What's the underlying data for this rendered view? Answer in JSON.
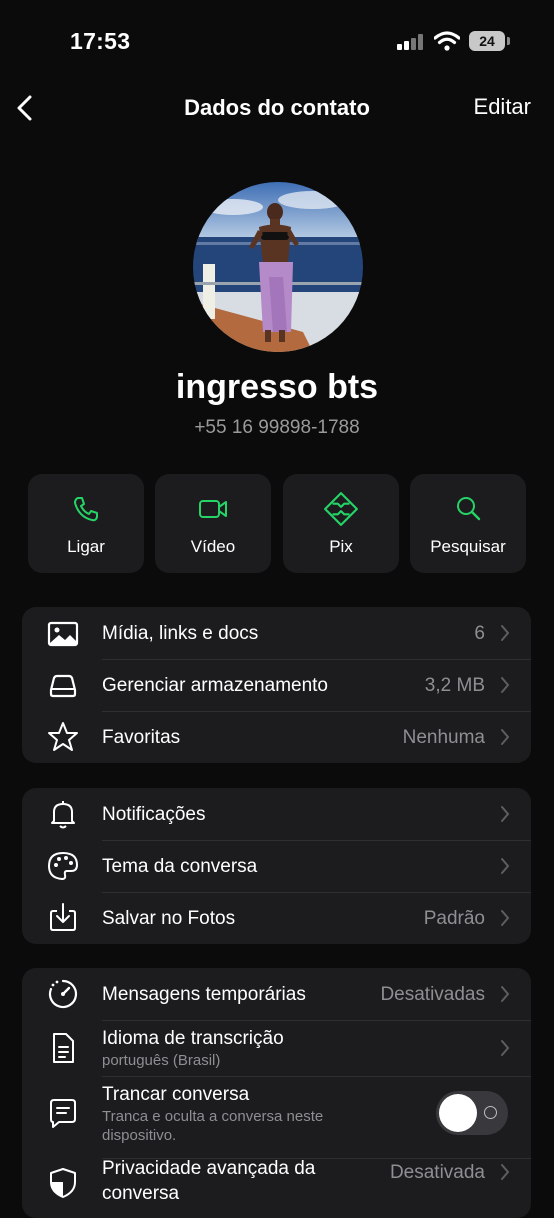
{
  "status_bar": {
    "time": "17:53",
    "battery": "24",
    "icons": [
      "cellular-signal-icon",
      "wifi-icon",
      "battery-icon"
    ]
  },
  "nav": {
    "title": "Dados do contato",
    "edit_label": "Editar",
    "back_icon": "chevron-left-icon"
  },
  "contact": {
    "name": "ingresso bts",
    "phone": "+55 16 99898-1788",
    "avatar_icon": "profile-photo"
  },
  "actions": [
    {
      "label": "Ligar",
      "icon": "phone-icon"
    },
    {
      "label": "Vídeo",
      "icon": "video-camera-icon"
    },
    {
      "label": "Pix",
      "icon": "pix-icon"
    },
    {
      "label": "Pesquisar",
      "icon": "search-icon"
    }
  ],
  "section1": [
    {
      "label": "Mídia, links e docs",
      "value": "6",
      "icon": "photo-icon"
    },
    {
      "label": "Gerenciar armazenamento",
      "value": "3,2 MB",
      "icon": "storage-icon"
    },
    {
      "label": "Favoritas",
      "value": "Nenhuma",
      "icon": "star-icon"
    }
  ],
  "section2": [
    {
      "label": "Notificações",
      "value": "",
      "icon": "bell-icon"
    },
    {
      "label": "Tema da conversa",
      "value": "",
      "icon": "palette-icon"
    },
    {
      "label": "Salvar no Fotos",
      "value": "Padrão",
      "icon": "download-icon"
    }
  ],
  "section3": [
    {
      "label": "Mensagens temporárias",
      "value": "Desativadas",
      "icon": "timer-icon"
    },
    {
      "label": "Idioma de transcrição",
      "sublabel": "português (Brasil)",
      "value": "",
      "icon": "document-icon"
    },
    {
      "label": "Trancar conversa",
      "sublabel": "Tranca e oculta a conversa neste dispositivo.",
      "toggle_on": false,
      "icon": "locked-chat-icon"
    },
    {
      "label": "Privacidade avançada da conversa",
      "value": "Desativada",
      "icon": "shield-icon"
    }
  ],
  "colors": {
    "background": "#0b0b0b",
    "card": "#1c1c1e",
    "accent_green": "#25d366",
    "secondary_text": "#8e8e93"
  }
}
